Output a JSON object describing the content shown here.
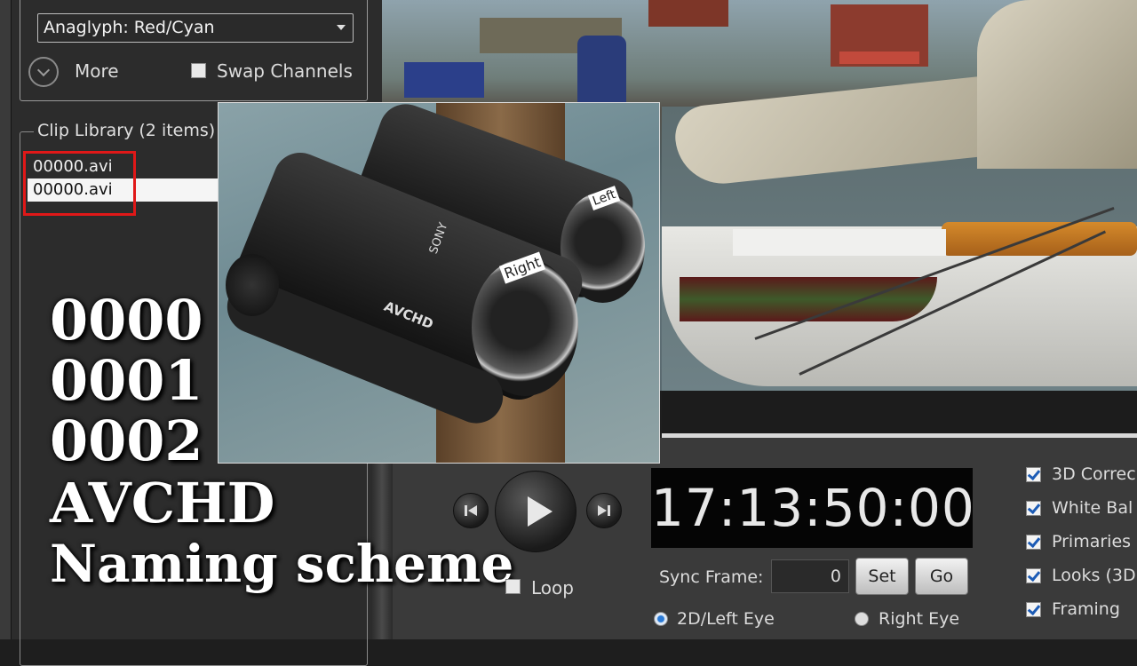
{
  "stereo_panel": {
    "dropdown_value": "Anaglyph: Red/Cyan",
    "more_label": "More",
    "swap_channels_label": "Swap Channels",
    "swap_channels_checked": false
  },
  "clip_library": {
    "title": "Clip Library (2 items)",
    "items": [
      {
        "name": "00000.avi",
        "selected": false
      },
      {
        "name": "00000.avi",
        "selected": true
      }
    ]
  },
  "overlay": {
    "lines": [
      "0000",
      "0001",
      "0002",
      "AVCHD",
      "Naming scheme"
    ]
  },
  "inset_photo": {
    "brand": "SONY",
    "format": "AVCHD",
    "left_tag": "Left",
    "right_tag": "Right"
  },
  "transport": {
    "loop_label": "Loop",
    "loop_checked": false,
    "timecode": "17:13:50:00",
    "sync_frame_label": "Sync Frame:",
    "sync_frame_value": "0",
    "set_label": "Set",
    "go_label": "Go",
    "eye_left_label": "2D/Left Eye",
    "eye_right_label": "Right Eye",
    "selected_eye": "left"
  },
  "corrections": [
    {
      "label": "3D Correc",
      "checked": true
    },
    {
      "label": "White  Bal",
      "checked": true
    },
    {
      "label": "Primaries",
      "checked": true
    },
    {
      "label": "Looks (3D",
      "checked": true
    },
    {
      "label": "Framing",
      "checked": true
    }
  ]
}
